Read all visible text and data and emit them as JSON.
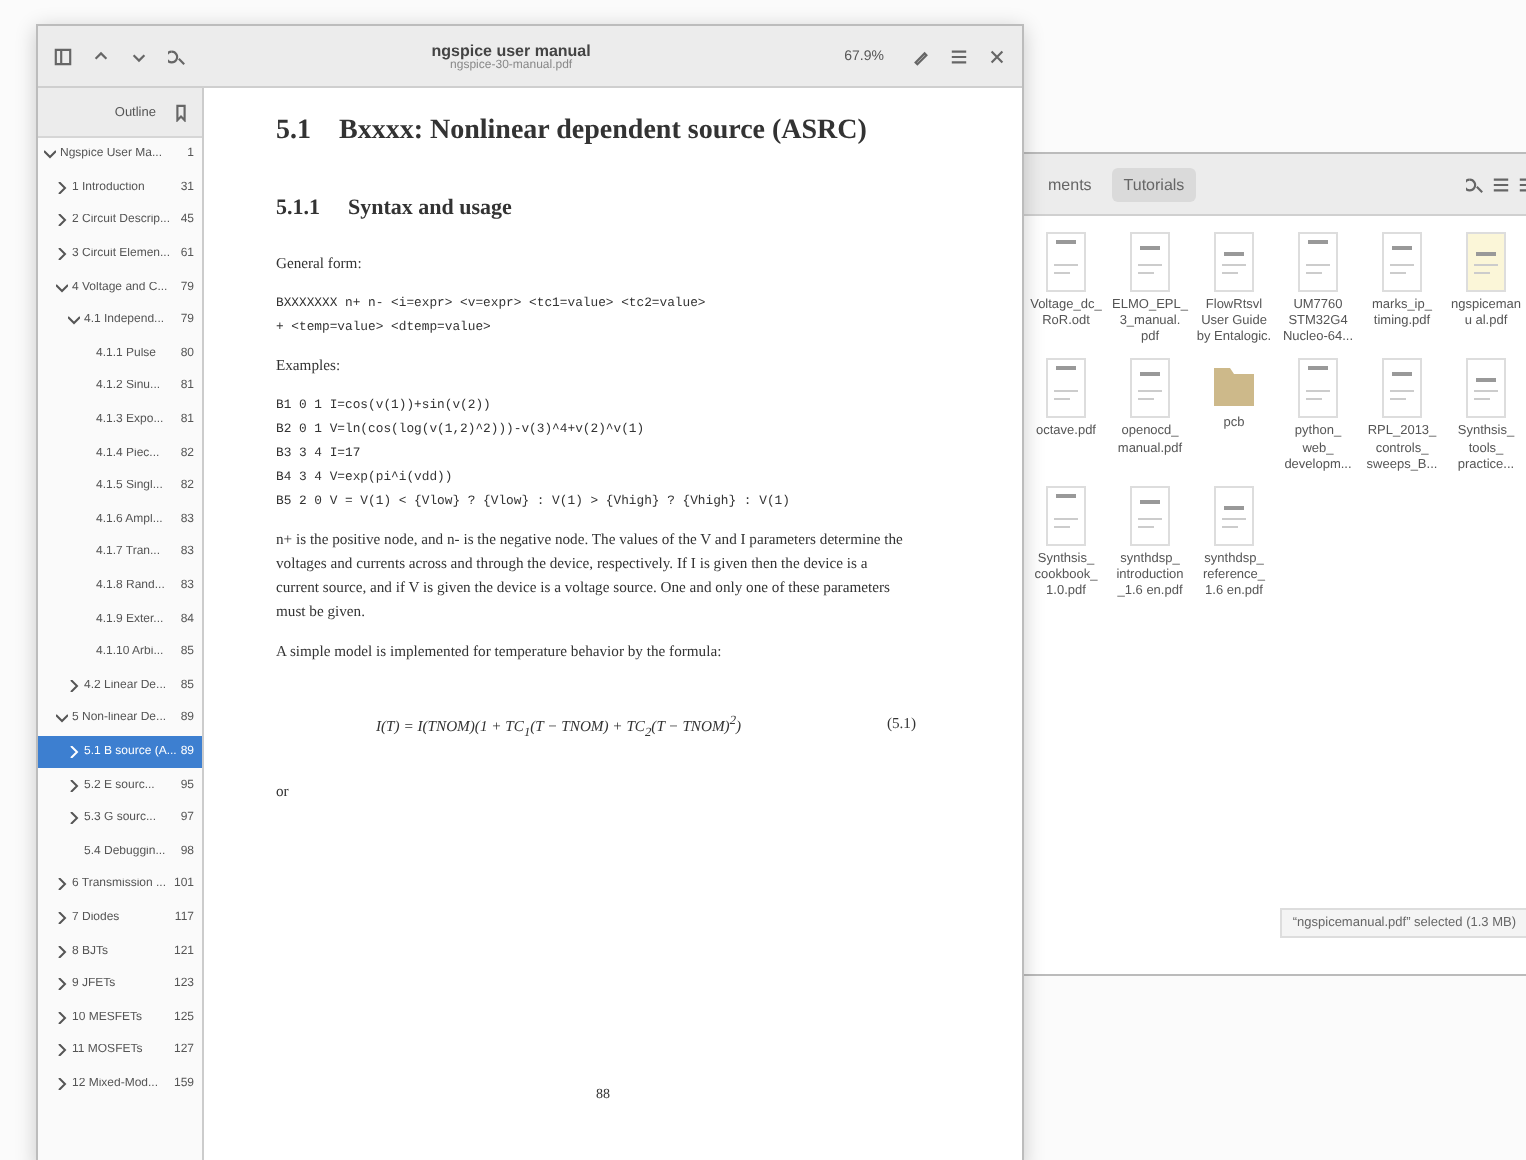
{
  "viewer": {
    "title": "ngspice user manual",
    "subtitle": "ngspice-30-manual.pdf",
    "zoom": "67.9%",
    "sidebar": {
      "mode": "Outline",
      "items": [
        {
          "label": "Ngspice User Ma...",
          "page": "1",
          "expanded": true,
          "selected": false,
          "children": [
            {
              "label": "1 Introduction",
              "page": "31",
              "expanded": false,
              "selected": false
            },
            {
              "label": "2 Circuit Descrip...",
              "page": "45",
              "expanded": false,
              "selected": false
            },
            {
              "label": "3 Circuit Elemen...",
              "page": "61",
              "expanded": false,
              "selected": false
            },
            {
              "label": "4 Voltage and C...",
              "page": "79",
              "expanded": true,
              "selected": false,
              "children": [
                {
                  "label": "4.1 Independ...",
                  "page": "79",
                  "expanded": true,
                  "selected": false,
                  "children": [
                    {
                      "label": "4.1.1 Pulse",
                      "page": "80",
                      "selected": false
                    },
                    {
                      "label": "4.1.2 Sinu...",
                      "page": "81",
                      "selected": false
                    },
                    {
                      "label": "4.1.3 Expo...",
                      "page": "81",
                      "selected": false
                    },
                    {
                      "label": "4.1.4 Piec...",
                      "page": "82",
                      "selected": false
                    },
                    {
                      "label": "4.1.5 Singl...",
                      "page": "82",
                      "selected": false
                    },
                    {
                      "label": "4.1.6 Ampl...",
                      "page": "83",
                      "selected": false
                    },
                    {
                      "label": "4.1.7 Tran...",
                      "page": "83",
                      "selected": false
                    },
                    {
                      "label": "4.1.8 Rand...",
                      "page": "83",
                      "selected": false
                    },
                    {
                      "label": "4.1.9 Exter...",
                      "page": "84",
                      "selected": false
                    },
                    {
                      "label": "4.1.10 Arbi...",
                      "page": "85",
                      "selected": false
                    }
                  ]
                },
                {
                  "label": "4.2 Linear De...",
                  "page": "85",
                  "expanded": false,
                  "selected": false
                }
              ]
            },
            {
              "label": "5 Non-linear De...",
              "page": "89",
              "expanded": true,
              "selected": false,
              "children": [
                {
                  "label": "5.1 B source (A...",
                  "page": "89",
                  "expanded": false,
                  "selected": true
                },
                {
                  "label": "5.2 E sourc...",
                  "page": "95",
                  "expanded": false,
                  "selected": false
                },
                {
                  "label": "5.3 G sourc...",
                  "page": "97",
                  "expanded": false,
                  "selected": false
                },
                {
                  "label": "5.4 Debuggin...",
                  "page": "98",
                  "selected": false
                }
              ]
            },
            {
              "label": "6 Transmission ...",
              "page": "101",
              "expanded": false,
              "selected": false
            },
            {
              "label": "7 Diodes",
              "page": "117",
              "expanded": false,
              "selected": false
            },
            {
              "label": "8 BJTs",
              "page": "121",
              "expanded": false,
              "selected": false
            },
            {
              "label": "9 JFETs",
              "page": "123",
              "expanded": false,
              "selected": false
            },
            {
              "label": "10 MESFETs",
              "page": "125",
              "expanded": false,
              "selected": false
            },
            {
              "label": "11 MOSFETs",
              "page": "127",
              "expanded": false,
              "selected": false
            },
            {
              "label": "12 Mixed-Mod...",
              "page": "159",
              "expanded": false,
              "selected": false
            }
          ]
        }
      ]
    },
    "page": {
      "blocks": [
        {
          "kind": "h2",
          "number": "5.1",
          "text": "Bxxxx: Nonlinear dependent source (ASRC)"
        },
        {
          "kind": "h3",
          "number": "5.1.1",
          "text": "Syntax and usage"
        },
        {
          "kind": "p",
          "text": "General form:"
        },
        {
          "kind": "code",
          "lines": [
            "BXXXXXXX n+ n- <i=expr> <v=expr> <tc1=value> <tc2=value>",
            "+ <temp=value> <dtemp=value>"
          ]
        },
        {
          "kind": "p",
          "text": "Examples:"
        },
        {
          "kind": "code",
          "lines": [
            "B1 0 1 I=cos(v(1))+sin(v(2))",
            "B2 0 1 V=ln(cos(log(v(1,2)^2)))-v(3)^4+v(2)^v(1)",
            "B3 3 4 I=17",
            "B4 3 4 V=exp(pi^i(vdd))",
            "B5 2 0 V = V(1) < {Vlow} ? {Vlow} : V(1) > {Vhigh} ? {Vhigh} : V(1)"
          ]
        },
        {
          "kind": "p",
          "text": "n+ is the positive node, and n- is the negative node. The values of the V and I parameters determine the voltages and currents across and through the device, respectively. If I is given then the device is a current source, and if V is given the device is a voltage source. One and only one of these parameters must be given."
        },
        {
          "kind": "p",
          "text": "A simple model is implemented for temperature behavior by the formula:"
        },
        {
          "kind": "eq",
          "text": "I(T) = I(TNOM)(1 + TC$_{1}$(T − TNOM) + TC$_{2}$(T − TNOM)$^{2}$)",
          "number": "(5.1)"
        },
        {
          "kind": "p",
          "text": "or"
        }
      ],
      "page_number": "88"
    }
  },
  "files": {
    "path": [
      {
        "label": "ments",
        "selected": false
      },
      {
        "label": "Tutorials",
        "selected": true
      }
    ],
    "items": [
      {
        "name": "Voltage_dc_ RoR.odt",
        "kind": "document",
        "selected": false
      },
      {
        "name": "ELMO_EPL_ 3_manual. pdf",
        "kind": "document",
        "selected": false
      },
      {
        "name": "FlowRtsvl User Guide by Entalogic.",
        "kind": "document",
        "selected": false
      },
      {
        "name": "UM7760 STM32G4 Nucleo-64...",
        "kind": "document",
        "selected": false
      },
      {
        "name": "marks_ip_ timing.pdf",
        "kind": "document",
        "selected": false
      },
      {
        "name": "ngspicemanu al.pdf",
        "kind": "document",
        "selected": true
      },
      {
        "name": "octave.pdf",
        "kind": "document",
        "selected": false
      },
      {
        "name": "openocd_ manual.pdf",
        "kind": "document",
        "selected": false
      },
      {
        "name": "pcb",
        "kind": "folder",
        "selected": false
      },
      {
        "name": "python_ web_ developm...",
        "kind": "document",
        "selected": false
      },
      {
        "name": "RPL_2013_ controls_ sweeps_B...",
        "kind": "document",
        "selected": false
      },
      {
        "name": "Synthsis_ tools_ practice...",
        "kind": "document",
        "selected": false
      },
      {
        "name": "Synthsis_ cookbook_ 1.0.pdf",
        "kind": "document",
        "selected": false
      },
      {
        "name": "synthdsp_ introduction _1.6 en.pdf",
        "kind": "document",
        "selected": false
      },
      {
        "name": "synthdsp_ reference_ 1.6 en.pdf",
        "kind": "document",
        "selected": false
      }
    ],
    "status": "“ngspicemanual.pdf” selected (1.3 MB)"
  }
}
